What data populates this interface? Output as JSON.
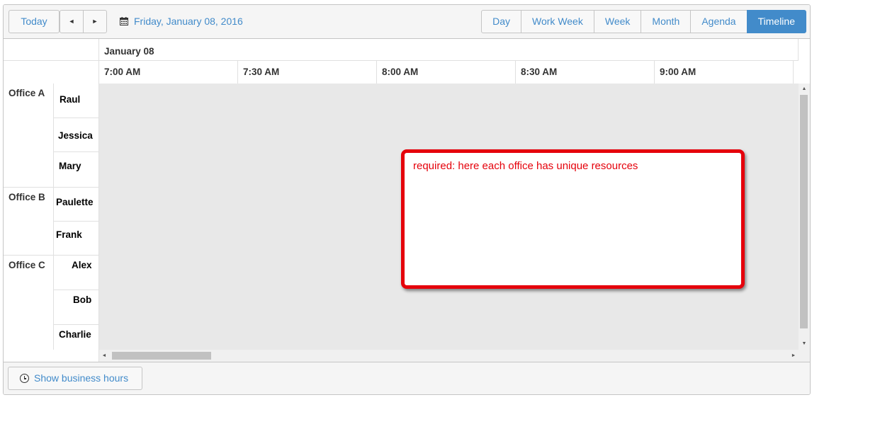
{
  "toolbar": {
    "today_label": "Today",
    "prev_icon": "triangle-left-icon",
    "prev_glyph": "◄",
    "next_icon": "triangle-right-icon",
    "next_glyph": "►",
    "date_icon": "calendar-icon",
    "date_label": "Friday, January 08, 2016",
    "views": [
      {
        "label": "Day",
        "selected": false
      },
      {
        "label": "Work Week",
        "selected": false
      },
      {
        "label": "Week",
        "selected": false
      },
      {
        "label": "Month",
        "selected": false
      },
      {
        "label": "Agenda",
        "selected": false
      },
      {
        "label": "Timeline",
        "selected": true
      }
    ]
  },
  "header": {
    "date": "January 08",
    "times": [
      "7:00 AM",
      "7:30 AM",
      "8:00 AM",
      "8:30 AM",
      "9:00 AM"
    ]
  },
  "offices": [
    {
      "name": "Office A",
      "resources": [
        "Raul",
        "Jessica",
        "Mary"
      ]
    },
    {
      "name": "Office B",
      "resources": [
        "Paulette",
        "Frank"
      ]
    },
    {
      "name": "Office C",
      "resources": [
        "Alex",
        "Bob",
        "Charlie"
      ]
    }
  ],
  "annotation": {
    "text": "required: here each office has unique resources"
  },
  "scrollbar": {
    "up_glyph": "▲",
    "down_glyph": "▼",
    "left_glyph": "◄",
    "right_glyph": "►"
  },
  "footer": {
    "business_hours_icon": "clock-icon",
    "business_hours_label": "Show business hours"
  },
  "colors": {
    "accent": "#428bca",
    "annotation": "#e5000b",
    "content_bg": "#e8e8e8"
  }
}
